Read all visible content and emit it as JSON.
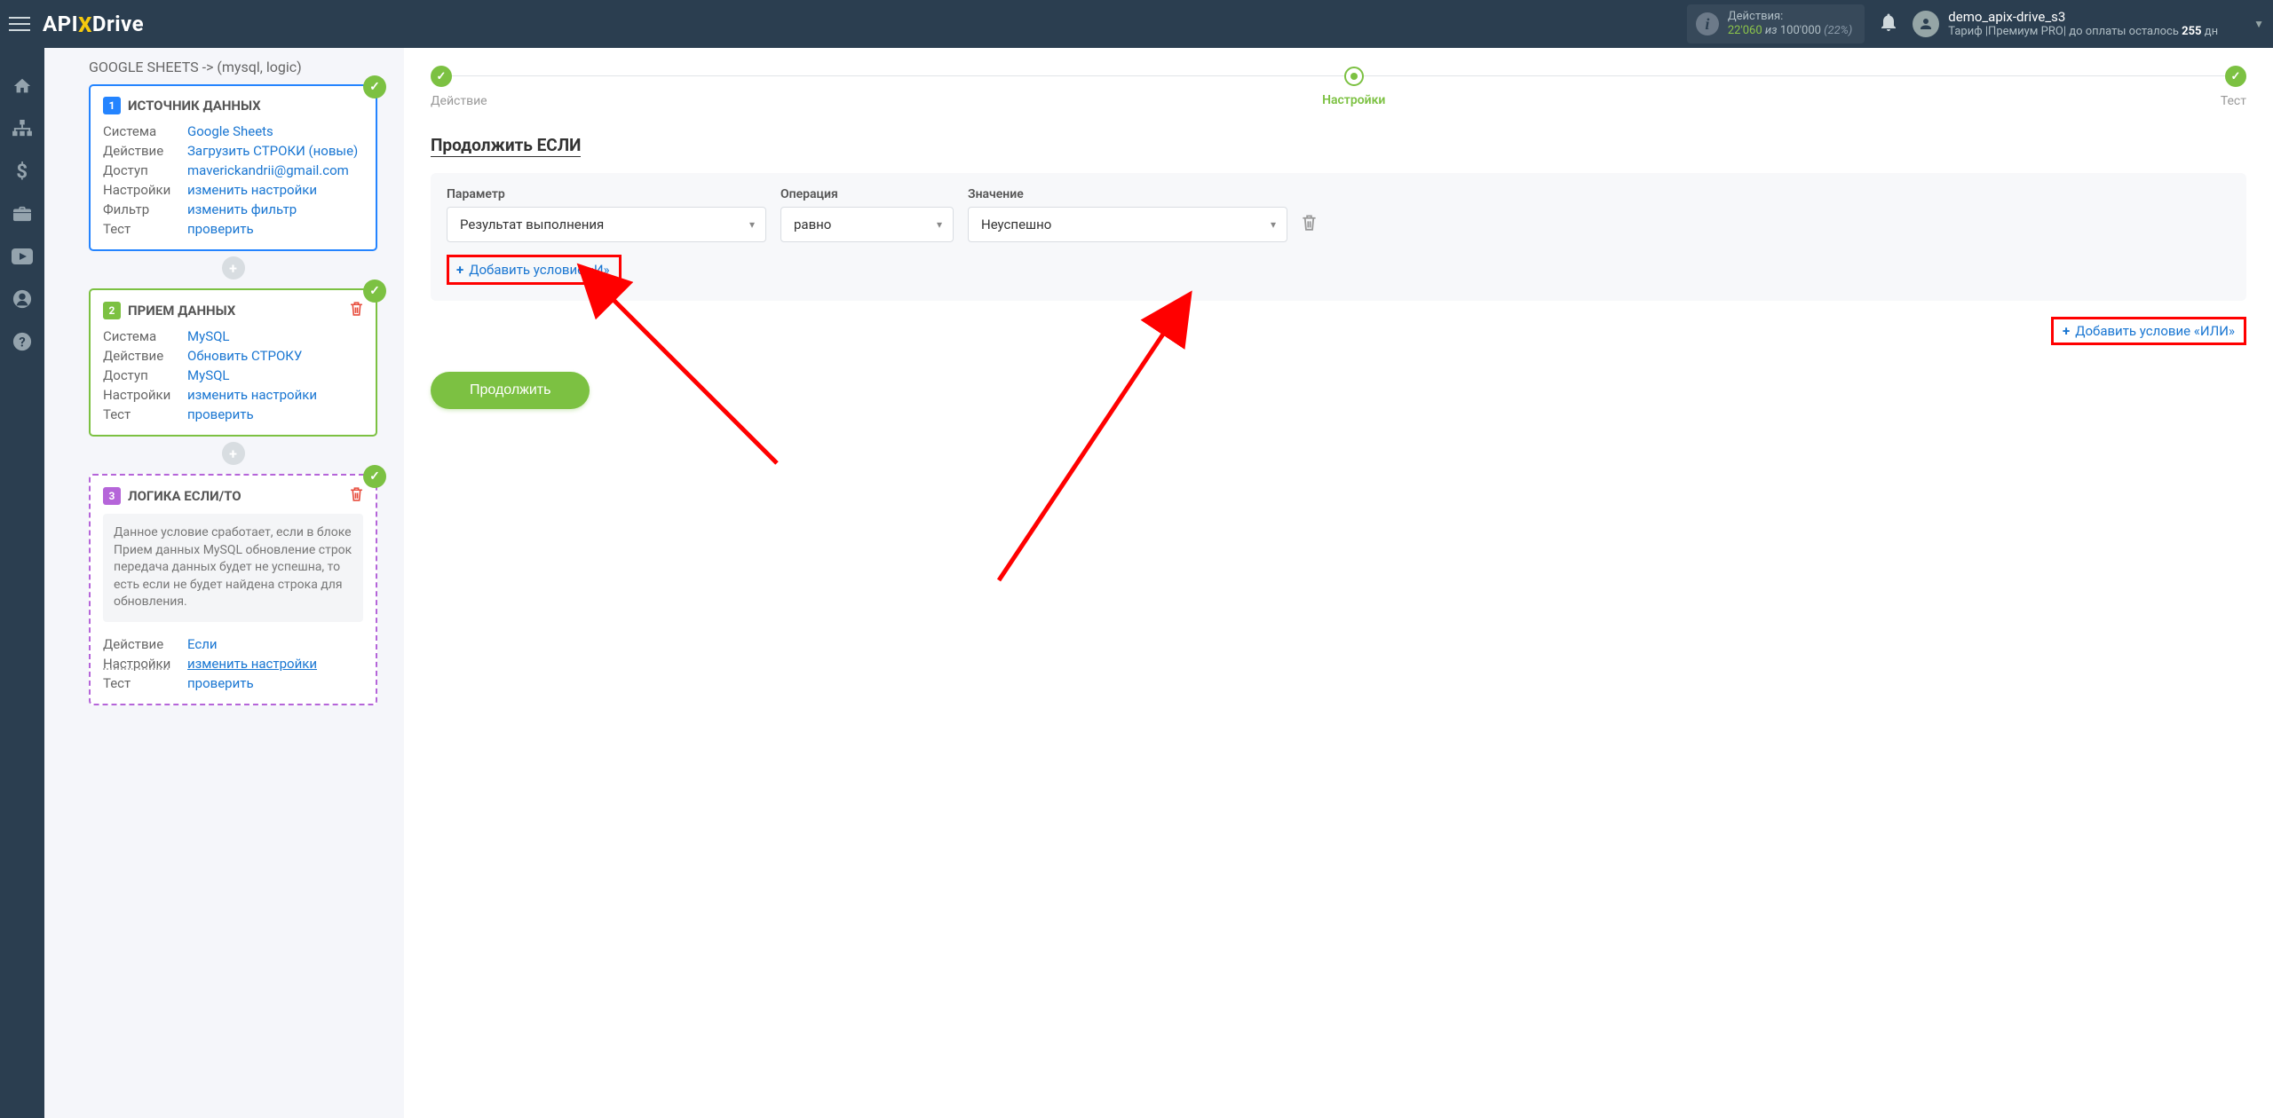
{
  "topbar": {
    "actions_label": "Действия:",
    "actions_used": "22'060",
    "actions_sep": "из",
    "actions_total": "100'000",
    "actions_pct": "(22%)",
    "username": "demo_apix-drive_s3",
    "tariff_prefix": "Тариф |Премиум PRO| до оплаты осталось ",
    "tariff_days_num": "255",
    "tariff_days_unit": " дн"
  },
  "left": {
    "title": "GOOGLE SHEETS -> (mysql, logic)",
    "block1": {
      "title": "ИСТОЧНИК ДАННЫХ",
      "rows": {
        "system_k": "Система",
        "system_v": "Google Sheets",
        "action_k": "Действие",
        "action_v": "Загрузить СТРОКИ (новые)",
        "access_k": "Доступ",
        "access_v": "maverickandrii@gmail.com",
        "settings_k": "Настройки",
        "settings_v": "изменить настройки",
        "filter_k": "Фильтр",
        "filter_v": "изменить фильтр",
        "test_k": "Тест",
        "test_v": "проверить"
      }
    },
    "block2": {
      "title": "ПРИЕМ ДАННЫХ",
      "rows": {
        "system_k": "Система",
        "system_v": "MySQL",
        "action_k": "Действие",
        "action_v": "Обновить СТРОКУ",
        "access_k": "Доступ",
        "access_v": "MySQL",
        "settings_k": "Настройки",
        "settings_v": "изменить настройки",
        "test_k": "Тест",
        "test_v": "проверить"
      }
    },
    "block3": {
      "title": "ЛОГИКА ЕСЛИ/ТО",
      "desc": "Данное условие сработает, если в блоке Прием данных MySQL обновление строк передача данных будет не успешна, то есть если не будет найдена строка для обновления.",
      "rows": {
        "action_k": "Действие",
        "action_v": "Если",
        "settings_k": "Настройки",
        "settings_v": "изменить настройки",
        "test_k": "Тест",
        "test_v": "проверить"
      }
    }
  },
  "main": {
    "steps": {
      "s1": "Действие",
      "s2": "Настройки",
      "s3": "Тест"
    },
    "section_title": "Продолжить ЕСЛИ",
    "cond": {
      "param_label": "Параметр",
      "op_label": "Операция",
      "val_label": "Значение",
      "param_value": "Результат выполнения",
      "op_value": "равно",
      "val_value": "Неуспешно",
      "add_and": "Добавить условие «И»",
      "add_or": "Добавить условие «ИЛИ»"
    },
    "continue": "Продолжить"
  }
}
